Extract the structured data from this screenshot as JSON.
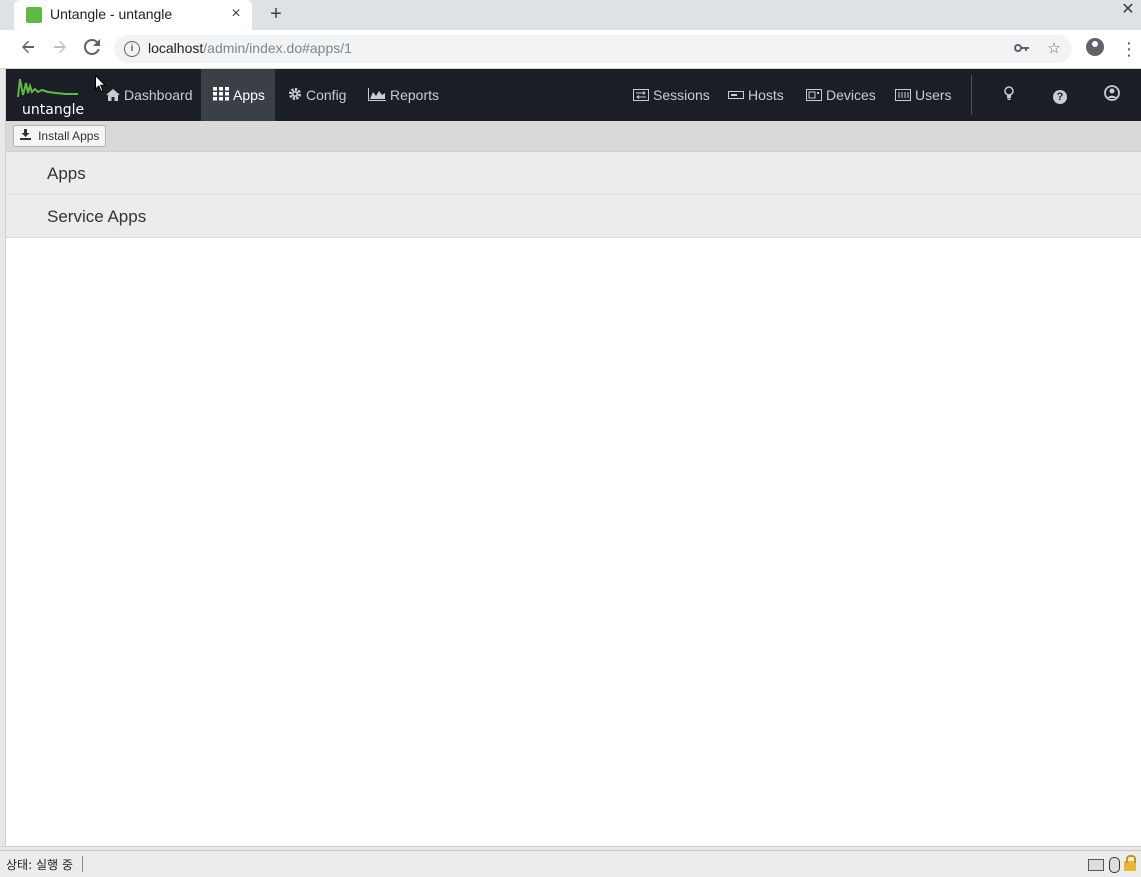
{
  "browser": {
    "tab_title": "Untangle - untangle",
    "tab_close": "×",
    "new_tab": "+",
    "window_close": "✕",
    "url_host": "localhost",
    "url_path": "/admin/index.do#apps/1"
  },
  "header": {
    "logo_text": "untangle",
    "nav_left": [
      {
        "label": "Dashboard",
        "icon": "home-icon",
        "active": false
      },
      {
        "label": "Apps",
        "icon": "grid-icon",
        "active": true
      },
      {
        "label": "Config",
        "icon": "gear-icon",
        "active": false
      },
      {
        "label": "Reports",
        "icon": "area-chart-icon",
        "active": false
      }
    ],
    "nav_right": [
      {
        "label": "Sessions",
        "icon": "sessions-icon"
      },
      {
        "label": "Hosts",
        "icon": "hosts-icon"
      },
      {
        "label": "Devices",
        "icon": "devices-icon"
      },
      {
        "label": "Users",
        "icon": "users-icon"
      }
    ],
    "help_glyph": "?"
  },
  "toolbar": {
    "install_label": "Install Apps"
  },
  "sections": [
    {
      "title": "Apps"
    },
    {
      "title": "Service Apps"
    }
  ],
  "statusbar": {
    "text": "상태: 실행 중"
  },
  "colors": {
    "header_bg": "#1b1e24",
    "active_nav_bg": "#3b3f46",
    "brand_green": "#5fb946"
  }
}
